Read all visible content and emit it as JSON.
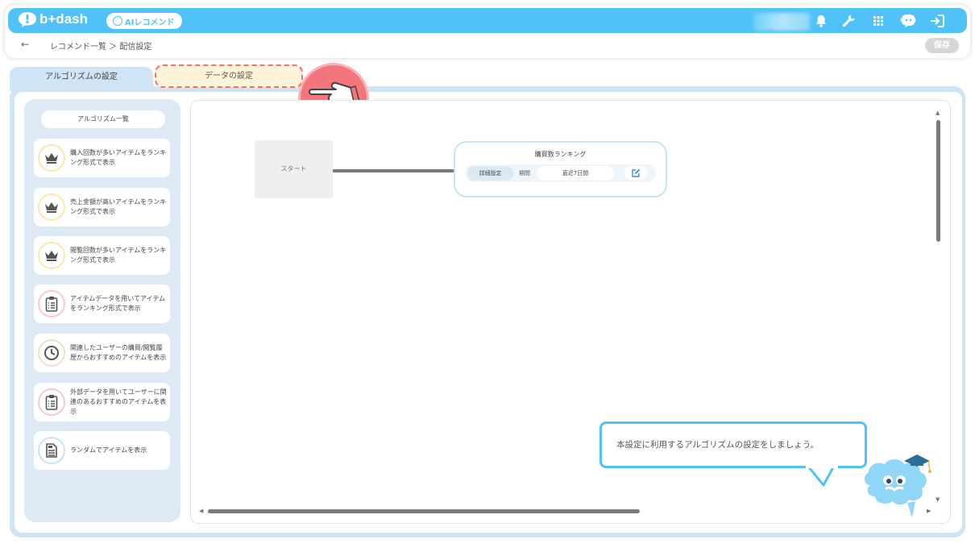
{
  "header": {
    "brand": "b+dash",
    "ai_button": "AIレコメンド"
  },
  "breadcrumb": {
    "back": "←",
    "path": "レコメンド一覧 ＞ 配信設定"
  },
  "toolbar": {
    "save_label": "保存"
  },
  "tabs": {
    "algorithm": "アルゴリズムの設定",
    "data": "データの設定"
  },
  "sidebar": {
    "title": "アルゴリズム一覧",
    "items": [
      {
        "icon": "crown-icon",
        "label": "購入回数が多いアイテムをランキング形式で表示"
      },
      {
        "icon": "crown-icon",
        "label": "売上金額が高いアイテムをランキング形式で表示"
      },
      {
        "icon": "crown-icon",
        "label": "閲覧回数が多いアイテムをランキング形式で表示"
      },
      {
        "icon": "clipboard-icon",
        "label": "アイテムデータを用いてアイテムをランキング形式で表示"
      },
      {
        "icon": "clock-icon",
        "label": "関連したユーザーの購買/閲覧履歴からおすすめのアイテムを表示"
      },
      {
        "icon": "clipboard-icon",
        "label": "外部データを用いてユーザーに関連のあるおすすめのアイテムを表示"
      },
      {
        "icon": "document-icon",
        "label": "ランダムでアイテムを表示"
      }
    ]
  },
  "flow": {
    "start_label": "スタート",
    "node": {
      "title": "購買数ランキング",
      "detail_button": "詳細設定",
      "period_label": "期間",
      "period_value": "直近7日間"
    }
  },
  "guide": {
    "message": "本設定に利用するアルゴリズムの設定をしましょう。"
  },
  "colors": {
    "primary": "#4fc3f7",
    "tab_highlight": "#fdf3d8",
    "accent_red": "#f2767b",
    "panel": "#cfe4f4"
  }
}
